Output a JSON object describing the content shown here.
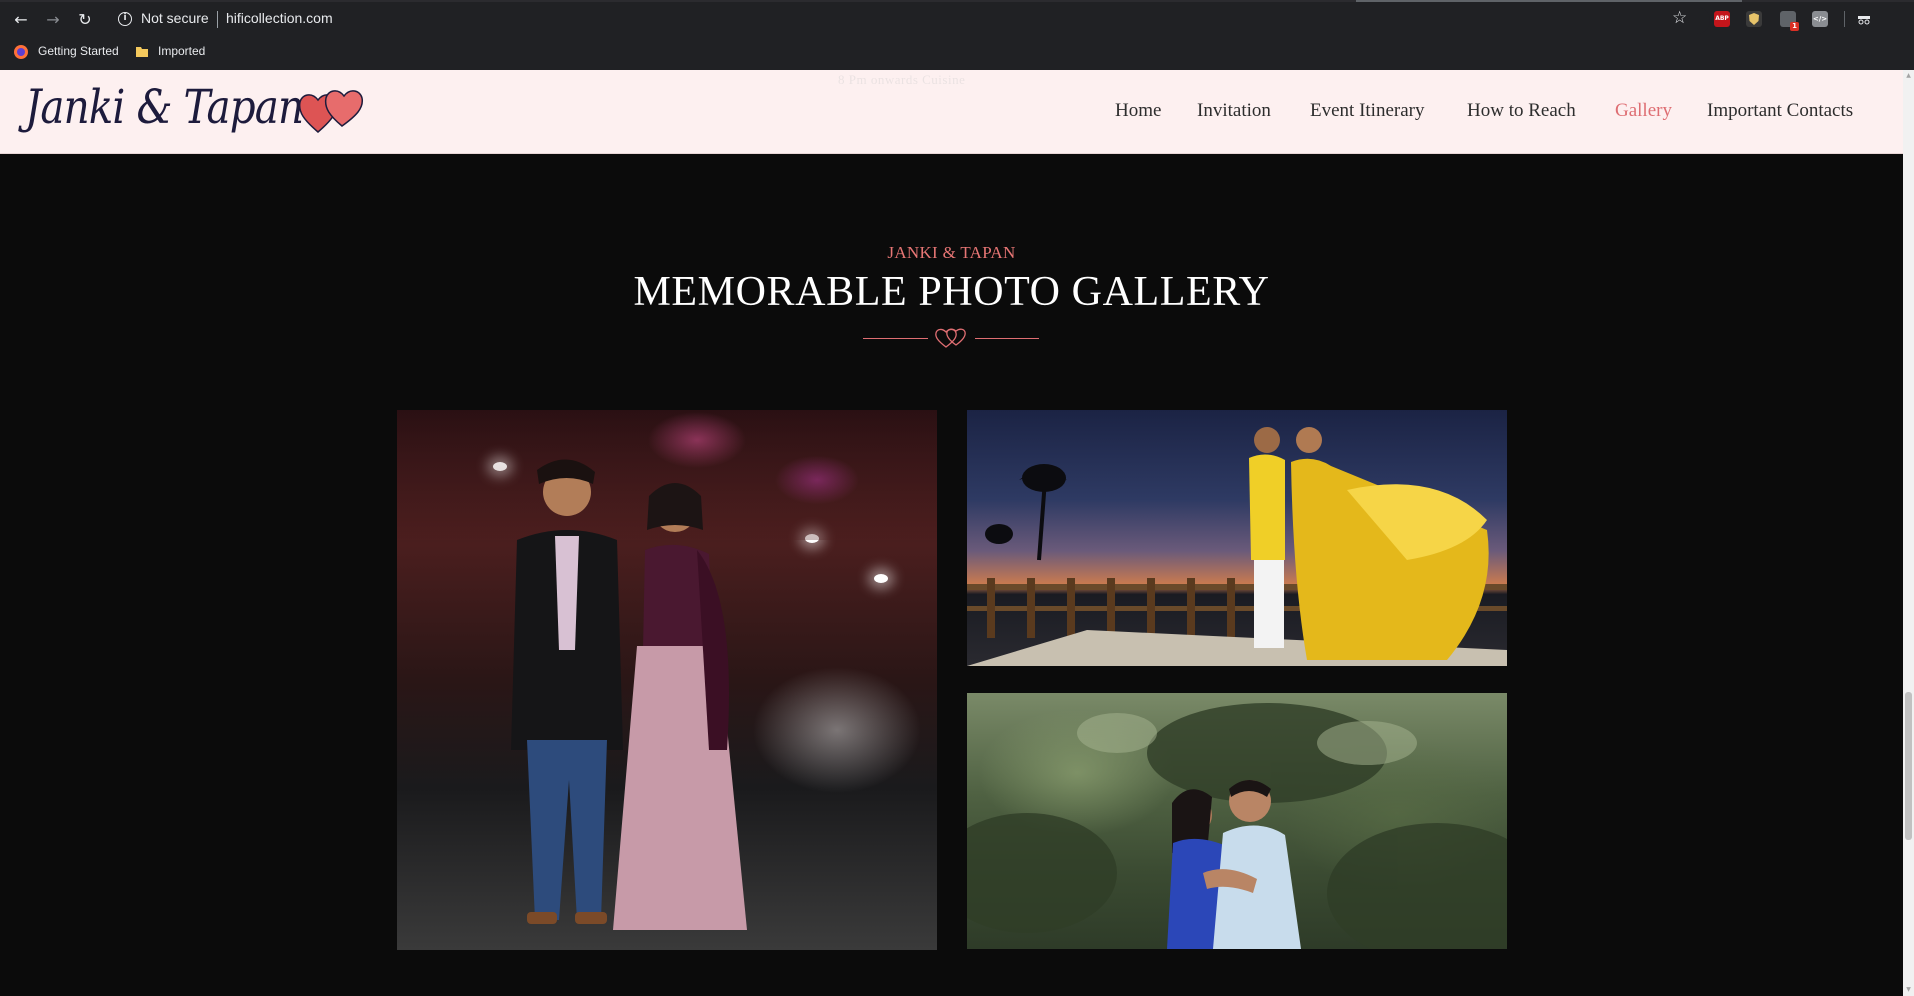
{
  "browser": {
    "back_label": "←",
    "forward_label": "→",
    "reload_label": "↻",
    "security_label": "Not secure",
    "url": "hificollection.com",
    "extensions": [
      "ABP"
    ],
    "extension_badge": "1",
    "bookmarks": [
      {
        "label": "Getting Started",
        "icon": "firefox-icon"
      },
      {
        "label": "Imported",
        "icon": "folder-icon"
      }
    ]
  },
  "site": {
    "logo_text": "Janki & Tapan",
    "faded_header_text": "8 Pm onwards Cuisine",
    "nav": [
      {
        "label": "Home",
        "active": false
      },
      {
        "label": "Invitation",
        "active": false
      },
      {
        "label": "Event Itinerary",
        "active": false
      },
      {
        "label": "How to Reach",
        "active": false
      },
      {
        "label": "Gallery",
        "active": true
      },
      {
        "label": "Important Contacts",
        "active": false
      }
    ],
    "accent_color": "#de6d72"
  },
  "gallery": {
    "kicker": "JANKI & TAPAN",
    "title": "MEMORABLE PHOTO GALLERY",
    "photos": [
      {
        "name": "couple-night-street-photo"
      },
      {
        "name": "couple-sunset-bridge-photo"
      },
      {
        "name": "couple-garden-photo"
      }
    ]
  }
}
